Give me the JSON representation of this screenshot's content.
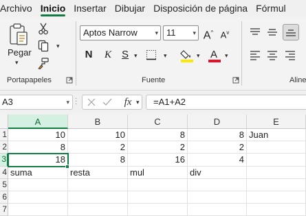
{
  "menu": {
    "tabs": [
      "Archivo",
      "Inicio",
      "Insertar",
      "Dibujar",
      "Disposición de página",
      "Fórmul"
    ],
    "active": "Inicio"
  },
  "ribbon": {
    "clipboard": {
      "paste_label": "Pegar",
      "group_label": "Portapapeles"
    },
    "font": {
      "font_name": "Aptos Narrow",
      "font_size": "11",
      "group_label": "Fuente",
      "highlight_color": "#ffe800",
      "font_color": "#e81123"
    },
    "alignment": {
      "group_label": "Aline"
    }
  },
  "formula_bar": {
    "name_box": "A3",
    "formula": "=A1+A2"
  },
  "grid": {
    "columns": [
      "A",
      "B",
      "C",
      "D",
      "E"
    ],
    "selected_column": "A",
    "selected_row": "3",
    "rows": [
      {
        "label": "1",
        "cells": [
          "10",
          "10",
          "8",
          "8",
          "Juan"
        ]
      },
      {
        "label": "2",
        "cells": [
          "8",
          "2",
          "2",
          "2",
          ""
        ]
      },
      {
        "label": "3",
        "cells": [
          "18",
          "8",
          "16",
          "4",
          ""
        ]
      },
      {
        "label": "4",
        "cells": [
          "suma",
          "resta",
          "mul",
          "div",
          ""
        ]
      },
      {
        "label": "5",
        "cells": [
          "",
          "",
          "",
          "",
          ""
        ]
      },
      {
        "label": "6",
        "cells": [
          "",
          "",
          "",
          "",
          ""
        ]
      },
      {
        "label": "7",
        "cells": [
          "",
          "",
          "",
          "",
          ""
        ]
      }
    ]
  }
}
